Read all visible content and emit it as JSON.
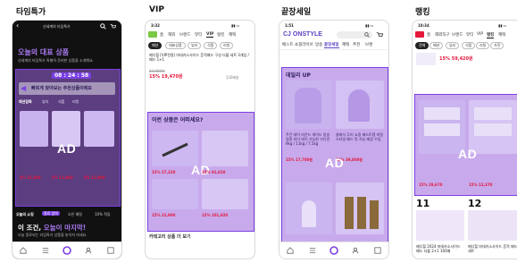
{
  "sections": [
    {
      "title": "타임특가"
    },
    {
      "title": "VIP"
    },
    {
      "title": "끝장세일"
    },
    {
      "title": "랭킹"
    }
  ],
  "ad_label": "AD",
  "phone1": {
    "header_title": "신세계의 타임특가",
    "headline": "오늘의 대표 상품",
    "subline": "신세계의 타임특가 특별히 준비한 상품을 소개해요.",
    "timer": "08 : 24 : 58",
    "banner_text": "빠르게 찾아보는 추천상품이에요",
    "tabs": [
      "패션잡화",
      "뷰티",
      "식품",
      "리빙"
    ],
    "bottom_tabs": [
      "오늘의 쇼핑",
      "종료 임박",
      "오픈 예정",
      "10% 적립"
    ],
    "bottom_headline_1": "이 조건,",
    "bottom_headline_2": "오늘이 마지막!",
    "bottom_sub": "오늘 종료되는 타임특가 상품을 놓치지 마세요.",
    "prices": [
      "4% 15,300",
      "6% 11,060",
      "8% 12,900"
    ]
  },
  "phone2": {
    "time": "3:32",
    "nav": [
      "홈",
      "해외",
      "브랜드",
      "뷰티",
      "VIP",
      "랭킹",
      "혜택"
    ],
    "filters": [
      "패션",
      "대표상품",
      "뷰티",
      "식품",
      "리빙"
    ],
    "product_name": "메디힐 [VIP전용] 마데카소사이드 흔적패드 구성 더블 세트 3개입 / 패드 1+1",
    "old_price": "23,900원",
    "price": "15% 19,470원",
    "tag": "무료배송",
    "recommend_title": "이런 상품은 어떠세요?",
    "grid_prices": [
      "15% 27,320",
      "15% 91,820",
      "15% 22,900",
      "15% 101,820"
    ],
    "more_text": "카테고리 상품 더 보기"
  },
  "phone3": {
    "logo": "CJ ONSTYLE",
    "nav": [
      "베스트",
      "쇼핑라이브",
      "방송",
      "끝장세일",
      "혜택",
      "추천",
      "브랜"
    ],
    "section": "데일리 UP",
    "desc_left": "주간 데이 라운드 데이드 방송 일정 하이 데이 가능한 가디언 9kg / 11kg / 7.5kg",
    "price_left": "15% 17,700원",
    "desc_right": "클래식 무리 쇼핑 베스트템 비밀 스타일 베드 핏 가능 매장 수입",
    "price_right": "14% 39,800원",
    "time": "1:51"
  },
  "phone4": {
    "time": "10:34",
    "nav": [
      "홈",
      "해외직구",
      "브랜드",
      "뷰티",
      "VIP",
      "랭킹",
      "혜택"
    ],
    "chips": [
      "전체",
      "패션",
      "뷰티",
      "식품",
      "리빙",
      "가전"
    ],
    "top_price": "15% 59,420원",
    "card_prices": [
      "15% 29,670",
      "15% 12,370"
    ],
    "rank_left": "11",
    "rank_right": "12",
    "bottom_desc": "메디힐 2024 마데카소사이드 패드 더블 2+1 100매",
    "bottom_desc_right": "메디힐 마데카소사이드 흔적 패드 세트"
  },
  "colors": {
    "accent": "#7b3fe4",
    "overlay": "#9b64dc",
    "dark": "#111111",
    "sale": "#e4173b"
  }
}
